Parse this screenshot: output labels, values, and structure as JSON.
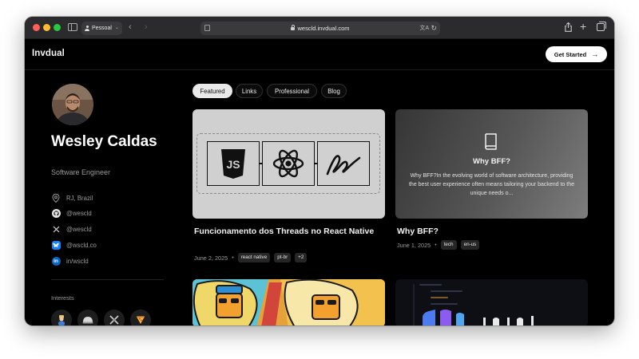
{
  "browser": {
    "profile": "Pessoal",
    "url": "wescld.invdual.com"
  },
  "site": {
    "logo": "Invdual",
    "cta": "Get Started"
  },
  "profile": {
    "name": "Wesley Caldas",
    "role": "Software Engineer",
    "location": "RJ, Brazil",
    "links": [
      {
        "icon": "github-icon",
        "label": "@wescld"
      },
      {
        "icon": "x-icon",
        "label": "@wescld"
      },
      {
        "icon": "bluesky-icon",
        "label": "@wscld.co"
      },
      {
        "icon": "linkedin-icon",
        "label": "in/wscld"
      }
    ],
    "interests_title": "Interests",
    "interests": [
      "person-icon",
      "helmet-icon",
      "tool-icon",
      "pizza-icon"
    ]
  },
  "tabs": [
    {
      "label": "Featured",
      "active": true
    },
    {
      "label": "Links",
      "active": false
    },
    {
      "label": "Professional",
      "active": false
    },
    {
      "label": "Blog",
      "active": false
    }
  ],
  "cards": [
    {
      "title": "Funcionamento dos Threads no React Native",
      "date": "June 2, 2025",
      "tags": [
        "react native",
        "pt-br",
        "+2"
      ]
    },
    {
      "image_title": "Why BFF?",
      "image_desc": "Why BFF?In the evolving world of software architecture, providing the best user experience often means tailoring your backend to the unique needs o...",
      "title": "Why BFF?",
      "date": "June 1, 2025",
      "tags": [
        "tech",
        "en-us"
      ]
    }
  ],
  "colors": {
    "background": "#000000",
    "accent_light": "#e9e9e9",
    "bluesky": "#1185fe",
    "linkedin": "#0a66c2"
  }
}
